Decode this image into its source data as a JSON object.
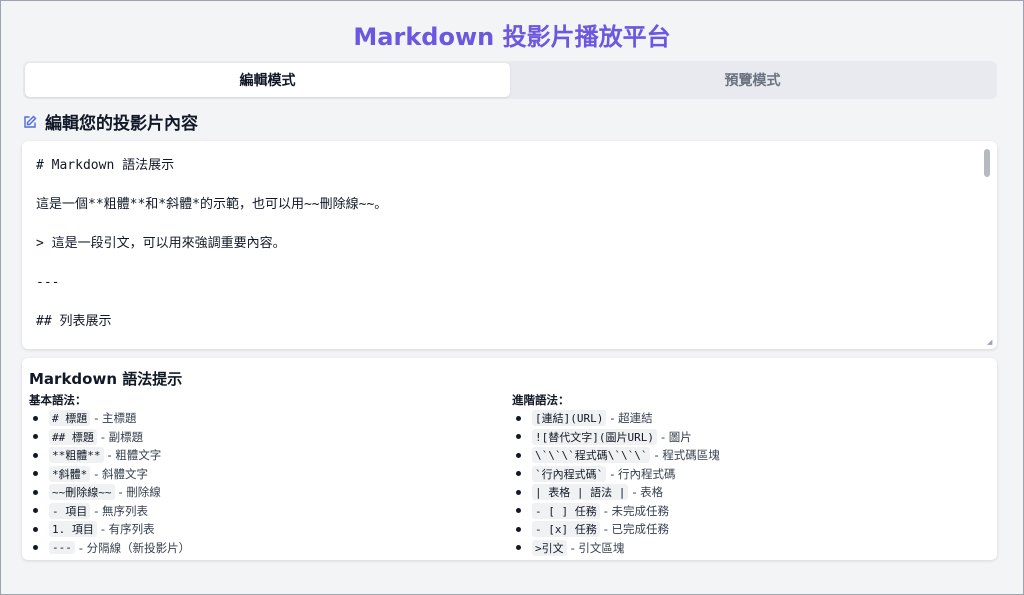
{
  "app": {
    "title": "Markdown 投影片播放平台"
  },
  "tabs": [
    {
      "label": "編輯模式",
      "active": true
    },
    {
      "label": "預覽模式",
      "active": false
    }
  ],
  "editor": {
    "heading": "編輯您的投影片內容",
    "lines": [
      "# Markdown 語法展示",
      "這是一個**粗體**和*斜體*的示範，也可以用~~刪除線~~。",
      "> 這是一段引文，可以用來強調重要內容。",
      "---",
      "## 列表展示"
    ]
  },
  "hints": {
    "title": "Markdown 語法提示",
    "basic": {
      "title": "基本語法：",
      "items": [
        {
          "code": "# 標題",
          "desc": "- 主標題"
        },
        {
          "code": "## 標題",
          "desc": "- 副標題"
        },
        {
          "code": "**粗體**",
          "desc": "- 粗體文字"
        },
        {
          "code": "*斜體*",
          "desc": "- 斜體文字"
        },
        {
          "code": "~~刪除線~~",
          "desc": "- 刪除線"
        },
        {
          "code": "- 項目",
          "desc": "- 無序列表"
        },
        {
          "code": "1. 項目",
          "desc": "- 有序列表"
        },
        {
          "code": "---",
          "desc": "- 分隔線（新投影片）"
        }
      ]
    },
    "advanced": {
      "title": "進階語法：",
      "items": [
        {
          "code": "[連結](URL)",
          "desc": "- 超連結"
        },
        {
          "code": "![替代文字](圖片URL)",
          "desc": "- 圖片"
        },
        {
          "code": "\\`\\`\\`程式碼\\`\\`\\`",
          "desc": "- 程式碼區塊"
        },
        {
          "code": "`行內程式碼`",
          "desc": "- 行內程式碼"
        },
        {
          "code": "| 表格 | 語法 |",
          "desc": "- 表格"
        },
        {
          "code": "- [ ] 任務",
          "desc": "- 未完成任務"
        },
        {
          "code": "- [x] 任務",
          "desc": "- 已完成任務"
        },
        {
          "code": ">引文",
          "desc": "- 引文區塊"
        }
      ]
    }
  },
  "colors": {
    "accent": "#6d56e0",
    "icon": "#4f6bdc"
  }
}
